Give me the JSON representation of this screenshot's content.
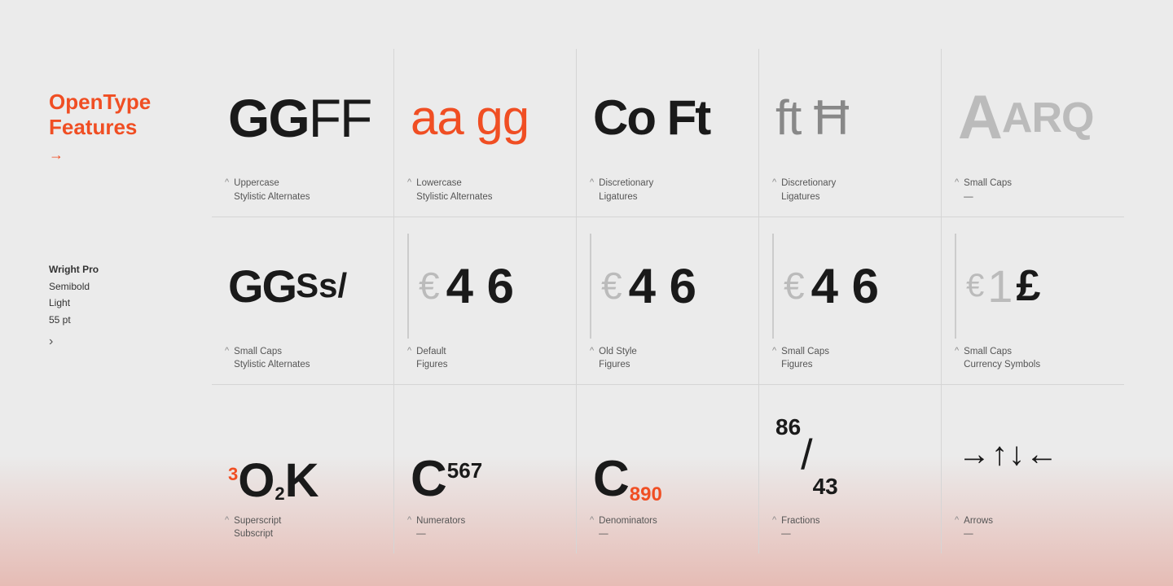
{
  "sidebar": {
    "title": "OpenType\nFeatures",
    "arrow": "→",
    "meta": {
      "font_name": "Wright Pro",
      "weight": "Semibold",
      "style": "Light",
      "size": "55 pt"
    },
    "chevron": "›"
  },
  "cells": [
    {
      "id": "uppercase-stylistic",
      "demo_label": "GG FF",
      "label_line1": "Uppercase",
      "label_line2": "Stylistic Alternates"
    },
    {
      "id": "lowercase-stylistic",
      "demo_label": "aa gg",
      "label_line1": "Lowercase",
      "label_line2": "Stylistic Alternates"
    },
    {
      "id": "disc-ligatures-1",
      "demo_label": "Co Ft",
      "label_line1": "Discretionary",
      "label_line2": "Ligatures"
    },
    {
      "id": "disc-ligatures-2",
      "demo_label": "ft H",
      "label_line1": "Discretionary",
      "label_line2": "Ligatures"
    },
    {
      "id": "small-caps",
      "demo_label": "AARQ",
      "label_line1": "Small Caps",
      "label_line2": "—"
    },
    {
      "id": "small-caps-stylistic",
      "demo_label": "GG Ss/",
      "label_line1": "Small Caps",
      "label_line2": "Stylistic Alternates"
    },
    {
      "id": "default-figures",
      "demo_label": "€ 4 6",
      "label_line1": "Default",
      "label_line2": "Figures"
    },
    {
      "id": "old-style-figures",
      "demo_label": "€ 4 6",
      "label_line1": "Old Style",
      "label_line2": "Figures"
    },
    {
      "id": "small-caps-figures",
      "demo_label": "€ 4 6",
      "label_line1": "Small Caps",
      "label_line2": "Figures"
    },
    {
      "id": "small-caps-currency",
      "demo_label": "€ 1 £",
      "label_line1": "Small Caps",
      "label_line2": "Currency Symbols"
    },
    {
      "id": "superscript-subscript",
      "demo_label": "³O₂K",
      "label_line1": "Superscript",
      "label_line2": "Subscript"
    },
    {
      "id": "numerators",
      "demo_label": "C⁵⁶⁷",
      "label_line1": "Numerators",
      "label_line2": "—"
    },
    {
      "id": "denominators",
      "demo_label": "C₈₉₀",
      "label_line1": "Denominators",
      "label_line2": "—"
    },
    {
      "id": "fractions",
      "demo_label": "⁸⁶/₄₃",
      "label_line1": "Fractions",
      "label_line2": "—"
    },
    {
      "id": "arrows",
      "demo_label": "→↑↓←",
      "label_line1": "Arrows",
      "label_line2": "—"
    }
  ]
}
